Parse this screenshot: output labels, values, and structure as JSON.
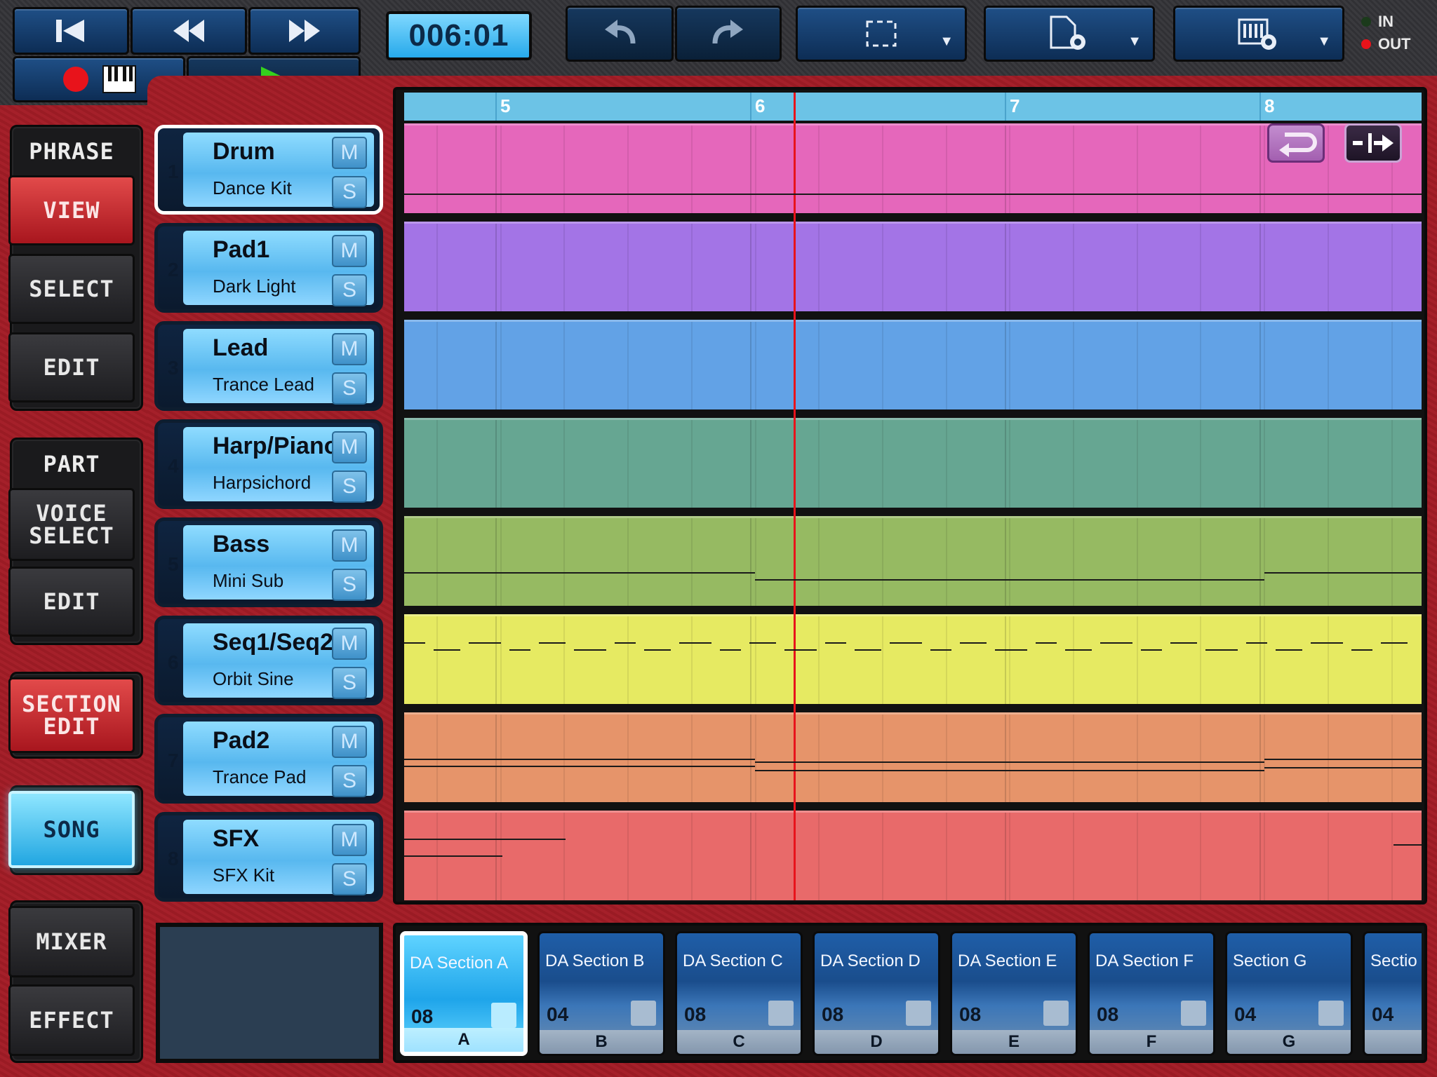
{
  "counter": "006:01",
  "io": {
    "in_label": "IN",
    "out_label": "OUT"
  },
  "icons": {
    "rewind_start": "skip-to-start-icon",
    "rewind": "rewind-icon",
    "fast_forward": "fast-forward-icon",
    "record": "record-icon",
    "keyboard": "keyboard-icon",
    "play": "play-icon",
    "undo": "undo-icon",
    "redo": "redo-icon",
    "select_region": "selection-icon",
    "file_settings": "file-settings-icon",
    "device_settings": "device-settings-icon",
    "loop": "loop-icon",
    "punch": "punch-icon"
  },
  "left_panel": {
    "phrase_header": "PHRASE",
    "view": "VIEW",
    "select": "SELECT",
    "edit": "EDIT",
    "part_header": "PART",
    "voice_select_1": "VOICE",
    "voice_select_2": "SELECT",
    "part_edit": "EDIT",
    "section_edit_1": "SECTION",
    "section_edit_2": "EDIT",
    "song": "SONG",
    "mixer": "MIXER",
    "effect": "EFFECT"
  },
  "tracks": [
    {
      "num": "1",
      "name": "Drum",
      "voice": "Dance Kit",
      "m": "M",
      "s": "S"
    },
    {
      "num": "2",
      "name": "Pad1",
      "voice": "Dark Light",
      "m": "M",
      "s": "S"
    },
    {
      "num": "3",
      "name": "Lead",
      "voice": "Trance Lead",
      "m": "M",
      "s": "S"
    },
    {
      "num": "4",
      "name": "Harp/Piano",
      "voice": "Harpsichord",
      "m": "M",
      "s": "S"
    },
    {
      "num": "5",
      "name": "Bass",
      "voice": "Mini Sub",
      "m": "M",
      "s": "S"
    },
    {
      "num": "6",
      "name": "Seq1/Seq2",
      "voice": "Orbit Sine",
      "m": "M",
      "s": "S"
    },
    {
      "num": "7",
      "name": "Pad2",
      "voice": "Trance Pad",
      "m": "M",
      "s": "S"
    },
    {
      "num": "8",
      "name": "SFX",
      "voice": "SFX Kit",
      "m": "M",
      "s": "S"
    }
  ],
  "ruler": [
    "5",
    "6",
    "7",
    "8"
  ],
  "lane_colors": [
    "#e567bb",
    "#a374e6",
    "#62a2e6",
    "#66a692",
    "#96ba62",
    "#e6ea62",
    "#e6946a",
    "#e86a6a"
  ],
  "sections": [
    {
      "name": "DA Section A",
      "length": "08",
      "letter": "A"
    },
    {
      "name": "DA Section B",
      "length": "04",
      "letter": "B"
    },
    {
      "name": "DA Section C",
      "length": "08",
      "letter": "C"
    },
    {
      "name": "DA Section D",
      "length": "08",
      "letter": "D"
    },
    {
      "name": "DA Section E",
      "length": "08",
      "letter": "E"
    },
    {
      "name": "DA Section F",
      "length": "08",
      "letter": "F"
    },
    {
      "name": "Section G",
      "length": "04",
      "letter": "G"
    },
    {
      "name": "Sectio",
      "length": "04",
      "letter": ""
    }
  ]
}
